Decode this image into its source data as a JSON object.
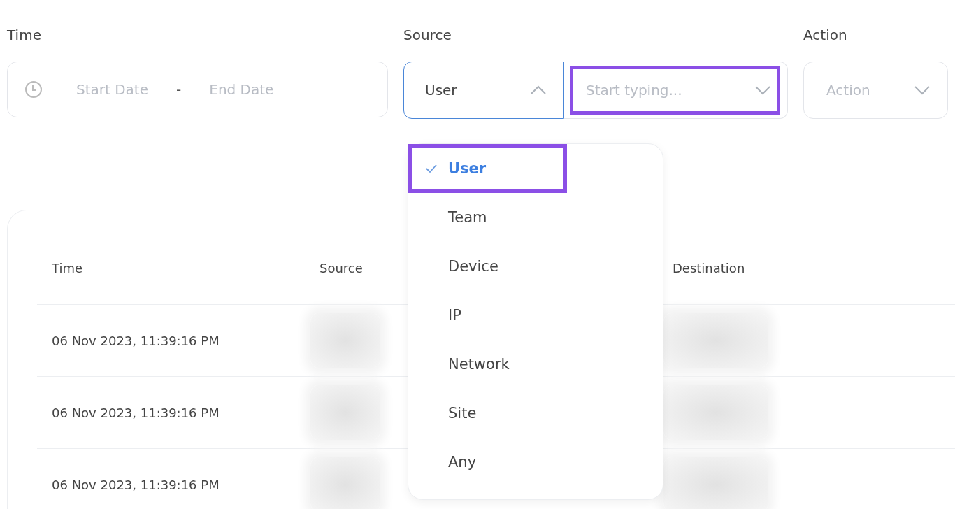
{
  "filters": {
    "time": {
      "label": "Time",
      "start_placeholder": "Start Date",
      "separator": "-",
      "end_placeholder": "End Date"
    },
    "source": {
      "label": "Source",
      "value": "User",
      "expanded": true,
      "search": {
        "placeholder": "Start typing...",
        "highlighted": true
      }
    },
    "action": {
      "label": "Action",
      "placeholder": "Action"
    }
  },
  "source_menu": [
    {
      "label": "User",
      "selected": true,
      "highlighted": true
    },
    {
      "label": "Team",
      "selected": false,
      "highlighted": false
    },
    {
      "label": "Device",
      "selected": false,
      "highlighted": false
    },
    {
      "label": "IP",
      "selected": false,
      "highlighted": false
    },
    {
      "label": "Network",
      "selected": false,
      "highlighted": false
    },
    {
      "label": "Site",
      "selected": false,
      "highlighted": false
    },
    {
      "label": "Any",
      "selected": false,
      "highlighted": false
    }
  ],
  "table": {
    "columns": [
      "Time",
      "Source",
      "Destination"
    ],
    "rows": [
      {
        "time": "06 Nov 2023, 11:39:16 PM",
        "source_blurred": true,
        "destination_blurred": true
      },
      {
        "time": "06 Nov 2023, 11:39:16 PM",
        "source_blurred": true,
        "destination_blurred": true
      },
      {
        "time": "06 Nov 2023, 11:39:16 PM",
        "source_blurred": true,
        "destination_blurred": true
      }
    ]
  }
}
